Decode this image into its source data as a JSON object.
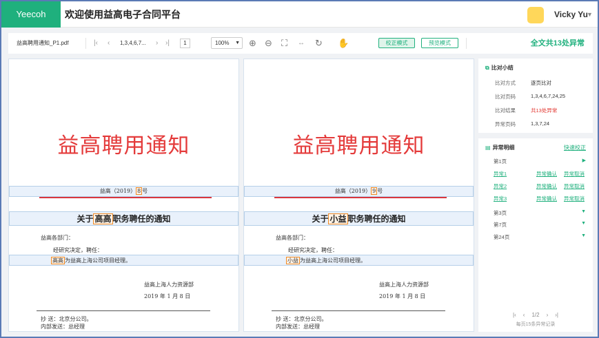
{
  "header": {
    "logo": "Yeecoh",
    "title": "欢迎使用益高电子合同平台",
    "username": "Vicky Yu"
  },
  "toolbar": {
    "filename": "益高聘用通知_P1.pdf",
    "pages": "1,3,4,6,7...",
    "current_page": "1",
    "zoom": "100%",
    "mode_proof": "校正模式",
    "mode_preview": "预览模式",
    "total_anomalies": "全文共13处异常"
  },
  "doc_left": {
    "title": "益高聘用通知",
    "num_prefix": "益高（2019）",
    "num_highlight": "8",
    "num_suffix": "号",
    "heading_prefix": "关于",
    "heading_highlight": "高高",
    "heading_suffix": "职务聘任的通知",
    "dept": "益高各部门：",
    "line1": "经研究决定，聘任：",
    "person_highlight": "高高",
    "person_rest": "为益高上海公司项目经理。",
    "sign_org": "益高上海人力资源部",
    "sign_date": "2019 年 1 月 8 日",
    "cc": "抄  送：北京分公司。",
    "internal": "内部发送：总经理"
  },
  "doc_right": {
    "title": "益高聘用通知",
    "num_prefix": "益高（2019）",
    "num_highlight": "9",
    "num_suffix": "号",
    "heading_prefix": "关于",
    "heading_highlight": "小益",
    "heading_suffix": "职务聘任的通知",
    "dept": "益高各部门：",
    "line1": "经研究决定，聘任：",
    "person_highlight": "小益",
    "person_rest": "为益高上海公司项目经理。",
    "sign_org": "益高上海人力资源部",
    "sign_date": "2019 年 1 月 8 日",
    "cc": "抄  送：北京分公司。",
    "internal": "内部发送：总经理"
  },
  "summary": {
    "title": "比对小结",
    "rows": [
      {
        "label": "比对方式",
        "value": "逐页比对"
      },
      {
        "label": "比对页码",
        "value": "1,3,4,6,7,24,25"
      },
      {
        "label": "比对结果",
        "value": "共13处异常"
      },
      {
        "label": "异常页码",
        "value": "1,3,7,24"
      }
    ]
  },
  "details": {
    "title": "异常明细",
    "quick": "快速校正",
    "page1": "第1页",
    "anomalies": [
      "异常1",
      "异常2",
      "异常3"
    ],
    "confirm": "异常确认",
    "cancel": "异常取消",
    "pages_collapsed": [
      "第3页",
      "第7页",
      "第24页"
    ],
    "pager": "1/2",
    "pager_note": "每页15条异常记录"
  },
  "colors": {
    "brand": "#1fb07d",
    "doc_title": "#e43b3b",
    "highlight_border": "#f08a24"
  }
}
